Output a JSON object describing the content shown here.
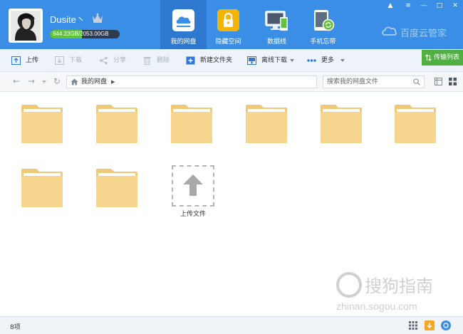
{
  "header": {
    "username": "Dusite丶",
    "quota_used": "944.23GB",
    "quota_total": "/2053.00GB",
    "quota_fraction": 0.46,
    "brand": "百度云管家",
    "nav_tabs": [
      {
        "label": "我的网盘",
        "icon": "cloud-disk-icon",
        "active": true
      },
      {
        "label": "隐藏空间",
        "icon": "lock-icon",
        "active": false
      },
      {
        "label": "数据线",
        "icon": "monitor-phone-icon",
        "active": false
      },
      {
        "label": "手机忘带",
        "icon": "phone-sync-icon",
        "active": false
      }
    ],
    "window_buttons": [
      "▲",
      "≡",
      "—",
      "□",
      "✕"
    ]
  },
  "toolbar": {
    "upload": "上传",
    "download": "下载",
    "share": "分享",
    "delete": "删除",
    "new_folder": "新建文件夹",
    "offline_download": "离线下载",
    "more": "更多",
    "transfer_list": "传输列表"
  },
  "addressbar": {
    "breadcrumb_root": "我的网盘",
    "search_placeholder": "搜索我的网盘文件"
  },
  "content": {
    "folder_count": 8,
    "upload_label": "上传文件"
  },
  "statusbar": {
    "item_count": "8项"
  },
  "watermark": {
    "text": "搜狗指南",
    "url": "zhinan.sogou.com"
  },
  "colors": {
    "header_blue": "#3a8ee6",
    "active_tab": "#2f78cf",
    "quota_green": "#62c23c",
    "transfer_green": "#52b043",
    "folder_body": "#f6d68e",
    "folder_back": "#efc878"
  }
}
